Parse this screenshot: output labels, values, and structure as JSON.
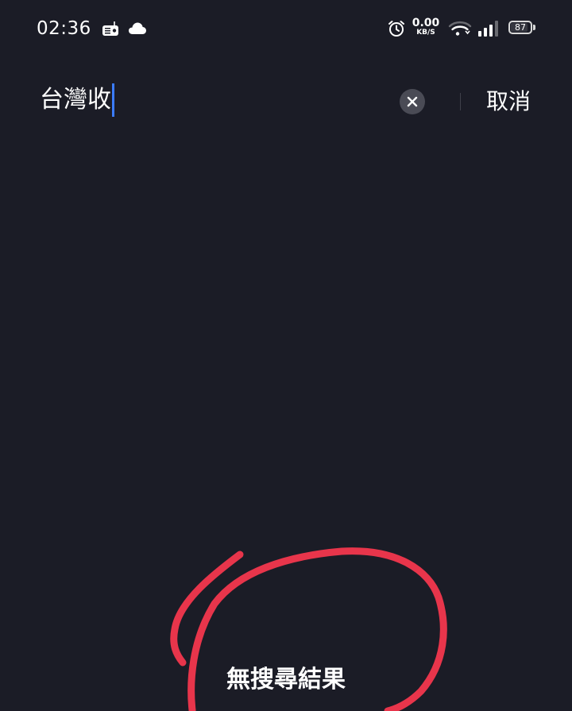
{
  "status_bar": {
    "time": "02:36",
    "net_speed_value": "0.00",
    "net_speed_unit": "KB/S",
    "battery_level": "87",
    "battery_fraction": 0.87,
    "icons": [
      "radio-icon",
      "cloud-icon",
      "alarm-icon",
      "wifi-icon",
      "signal-icon",
      "battery-icon"
    ]
  },
  "search": {
    "value": "台灣收",
    "cancel_label": "取消",
    "clear_icon": "close-icon",
    "caret_color": "#3b7cff"
  },
  "results": {
    "empty_message": "無搜尋結果"
  },
  "annotation": {
    "shape": "hand-drawn circle",
    "color": "#e8354b"
  },
  "colors": {
    "background": "#1b1c26",
    "text": "#ffffff"
  }
}
